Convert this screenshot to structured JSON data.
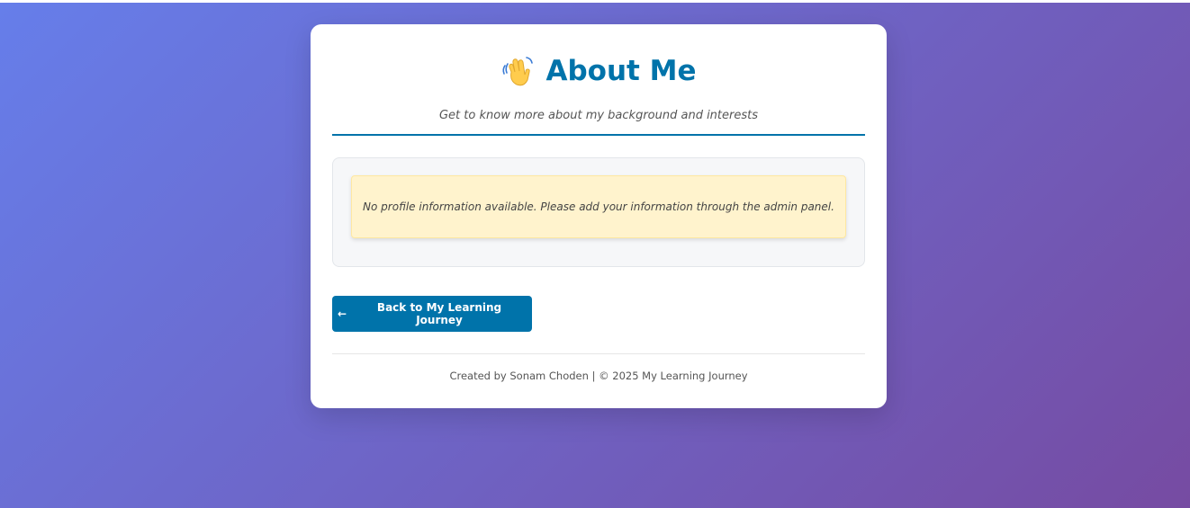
{
  "page": {
    "title": "About Me",
    "title_icon": "waving-hand-icon",
    "subtitle": "Get to know more about my background and interests"
  },
  "profile": {
    "empty_message": "No profile information available. Please add your information through the admin panel."
  },
  "navigation": {
    "back_arrow": "←",
    "back_label": "Back to My Learning Journey"
  },
  "footer": {
    "text": "Created by Sonam Choden | © 2025 My Learning Journey"
  },
  "colors": {
    "accent": "#0073aa",
    "background_gradient_start": "#667eea",
    "background_gradient_end": "#764ba2",
    "notice_background": "#fff3cd"
  }
}
